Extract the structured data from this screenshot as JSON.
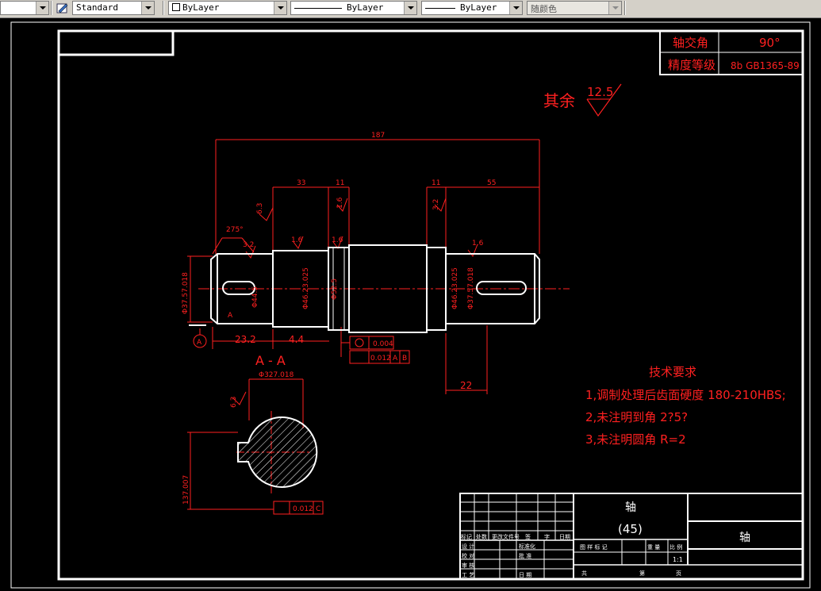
{
  "toolbar": {
    "textstyle": "Standard",
    "layer": "ByLayer",
    "linetype": "ByLayer",
    "lineweight": "ByLayer",
    "plotstyle": "随颜色"
  },
  "drawing": {
    "colors": {
      "red": "#ff2020",
      "white": "#ffffff",
      "background": "#000000"
    },
    "top_table": {
      "row1_label": "轴交角",
      "row1_value": "90°",
      "row2_label": "精度等级",
      "row2_value": "8b GB1365-89"
    },
    "roughness": {
      "prefix": "其余",
      "value": "12.5"
    },
    "dims": {
      "overall": "187",
      "d33": "33",
      "d11a": "11",
      "d11b": "11",
      "d55": "55",
      "angle": "275°",
      "r63a": "6.3",
      "r32a": "3.2",
      "r16a": "1.6",
      "r16b": "1.6",
      "r16c": "1.6",
      "r32b": "3.2",
      "r16d": "1.6",
      "r63b": "6.3",
      "dia1": "Φ37.57.018",
      "dia2": "Φ44.5",
      "dia3": "Φ46.23.025",
      "dia4": "Φ52.5",
      "dia5": "Φ46.23.025",
      "dia6": "Φ37.57.018",
      "d23": "23.2",
      "d44": "4.4",
      "d22": "22",
      "tol1": "0.004",
      "tol2": "0.012",
      "datumA": "A",
      "datumB": "B",
      "sectionA_label": "A",
      "sectionA_circle": "A",
      "sec_dia": "Φ327.018",
      "sec_r": "6.3",
      "sec_h": "137.007",
      "sec_tol": "0.012",
      "sec_datum": "C"
    },
    "section_title": "A - A",
    "notes": {
      "title": "技术要求",
      "line1": "1,调制处理后齿面硬度 180-210HBS;",
      "line2": "2,未注明到角 2?5?",
      "line3": "3,未注明圆角 R=2"
    },
    "title_block": {
      "part_name": "轴",
      "material": "(45)",
      "drawing_name": "轴",
      "row_labels": [
        "标记",
        "处数",
        "更改文件号",
        "签",
        "字",
        "日期"
      ],
      "designer": "设 计",
      "check": "校 对",
      "review": "审 核",
      "craft": "工 艺",
      "std": "标准化",
      "approve": "批 准",
      "date": "日 期",
      "stage": "图 样 标 记",
      "weight": "重 量",
      "scale_label": "比 例",
      "scale": "1:1",
      "sheet": "共",
      "page": "页",
      "of": "第"
    }
  }
}
